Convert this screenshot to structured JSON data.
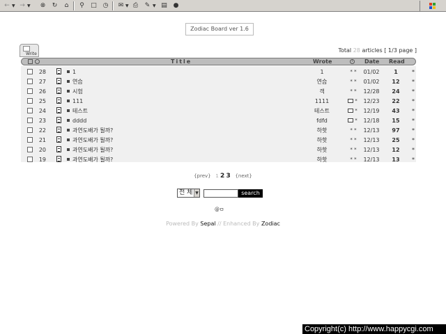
{
  "toolbar": {
    "buttons": [
      "back-icon",
      "forward-icon",
      "stop-icon",
      "refresh-icon",
      "home-icon",
      "search-icon",
      "folder-icon",
      "history-icon",
      "mail-icon",
      "print-icon",
      "edit-icon",
      "discuss-icon",
      "messenger-icon"
    ]
  },
  "board": {
    "version": "Zodiac Board ver 1.6",
    "write_label": "Write"
  },
  "summary": {
    "prefix": "Total",
    "total": "28",
    "articles_label": "articles [",
    "page": "1/3",
    "page_suffix": "page ]"
  },
  "header": {
    "title": "Title",
    "wrote": "Wrote",
    "info_icon": "i",
    "date": "Date",
    "read": "Read"
  },
  "rows": [
    {
      "num": "28",
      "title": "1",
      "wrote": "1",
      "mail": false,
      "date": "01/02",
      "read": "1",
      "end": "*"
    },
    {
      "num": "27",
      "title": "연습",
      "wrote": "연습",
      "mail": false,
      "date": "01/02",
      "read": "12",
      "end": "*"
    },
    {
      "num": "26",
      "title": "시험",
      "wrote": "객",
      "mail": false,
      "date": "12/28",
      "read": "24",
      "end": "*"
    },
    {
      "num": "25",
      "title": "111",
      "wrote": "1111",
      "mail": true,
      "date": "12/23",
      "read": "22",
      "end": "*"
    },
    {
      "num": "24",
      "title": "테스트",
      "wrote": "테스트",
      "mail": true,
      "date": "12/19",
      "read": "43",
      "end": "*"
    },
    {
      "num": "23",
      "title": "dddd",
      "wrote": "fdfd",
      "mail": true,
      "date": "12/18",
      "read": "15",
      "end": "*"
    },
    {
      "num": "22",
      "title": "과연도배가 될까?",
      "wrote": "하핫",
      "mail": false,
      "date": "12/13",
      "read": "97",
      "end": "*"
    },
    {
      "num": "21",
      "title": "과연도배가 될까?",
      "wrote": "하핫",
      "mail": false,
      "date": "12/13",
      "read": "25",
      "end": "*"
    },
    {
      "num": "20",
      "title": "과연도배가 될까?",
      "wrote": "하핫",
      "mail": false,
      "date": "12/13",
      "read": "12",
      "end": "*"
    },
    {
      "num": "19",
      "title": "과연도배가 될까?",
      "wrote": "하핫",
      "mail": false,
      "date": "12/13",
      "read": "13",
      "end": "*"
    }
  ],
  "pagination": {
    "prev": "{prev}",
    "current": "1",
    "pages": [
      "2",
      "3"
    ],
    "next": "{next}"
  },
  "search": {
    "scope": "전 체",
    "value": "",
    "button": "search"
  },
  "small_icon_label": "@ㅁ",
  "footer": {
    "powered_by": "Powered By",
    "sepal": "Sepal",
    "enhanced_by": "// Enhanced By",
    "zodiac": "Zodiac"
  },
  "copyright": "Copyright(c) http://www.happycgi.com"
}
